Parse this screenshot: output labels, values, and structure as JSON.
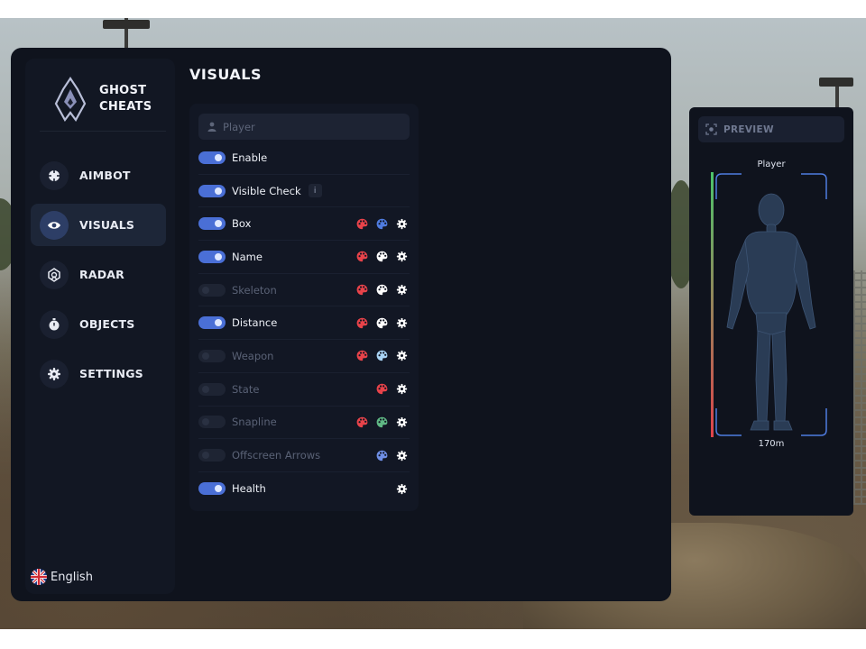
{
  "brand": {
    "line1": "GHOST",
    "line2": "CHEATS"
  },
  "nav": [
    {
      "id": "aimbot",
      "label": "AIMBOT",
      "icon": "crosshair-icon",
      "active": false
    },
    {
      "id": "visuals",
      "label": "VISUALS",
      "icon": "eye-icon",
      "active": true
    },
    {
      "id": "radar",
      "label": "RADAR",
      "icon": "radar-icon",
      "active": false
    },
    {
      "id": "objects",
      "label": "OBJECTS",
      "icon": "stopwatch-icon",
      "active": false
    },
    {
      "id": "settings",
      "label": "SETTINGS",
      "icon": "gear-icon",
      "active": false
    }
  ],
  "language": {
    "label": "English",
    "flag": "uk-flag-icon"
  },
  "page": {
    "title": "VISUALS"
  },
  "filter": {
    "label": "Player",
    "icon": "user-icon"
  },
  "options": [
    {
      "label": "Enable",
      "on": true,
      "info": false,
      "colors": [],
      "gear": false
    },
    {
      "label": "Visible Check",
      "on": true,
      "info": true,
      "colors": [],
      "gear": false
    },
    {
      "label": "Box",
      "on": true,
      "info": false,
      "colors": [
        "#e8434a",
        "#4f7ce0"
      ],
      "gear": true
    },
    {
      "label": "Name",
      "on": true,
      "info": false,
      "colors": [
        "#e8434a",
        "#ffffff"
      ],
      "gear": true
    },
    {
      "label": "Skeleton",
      "on": false,
      "info": false,
      "colors": [
        "#e8434a",
        "#ffffff"
      ],
      "gear": true
    },
    {
      "label": "Distance",
      "on": true,
      "info": false,
      "colors": [
        "#e8434a",
        "#ffffff"
      ],
      "gear": true
    },
    {
      "label": "Weapon",
      "on": false,
      "info": false,
      "colors": [
        "#e8434a",
        "#a9d4f5"
      ],
      "gear": true
    },
    {
      "label": "State",
      "on": false,
      "info": false,
      "colors": [
        "#e8434a"
      ],
      "gear": true
    },
    {
      "label": "Snapline",
      "on": false,
      "info": false,
      "colors": [
        "#e8434a",
        "#5fb884"
      ],
      "gear": true
    },
    {
      "label": "Offscreen Arrows",
      "on": false,
      "info": false,
      "colors": [
        "#6f8fe6"
      ],
      "gear": true
    },
    {
      "label": "Health",
      "on": true,
      "info": false,
      "colors": [],
      "gear": true
    }
  ],
  "info_glyph": "i",
  "preview": {
    "title": "PREVIEW",
    "icon": "camera-scan-icon",
    "player_name": "Player",
    "distance": "170m",
    "box_color": "#4f7ce0",
    "health_colors": [
      "#4cc46a",
      "#e0434a"
    ]
  }
}
